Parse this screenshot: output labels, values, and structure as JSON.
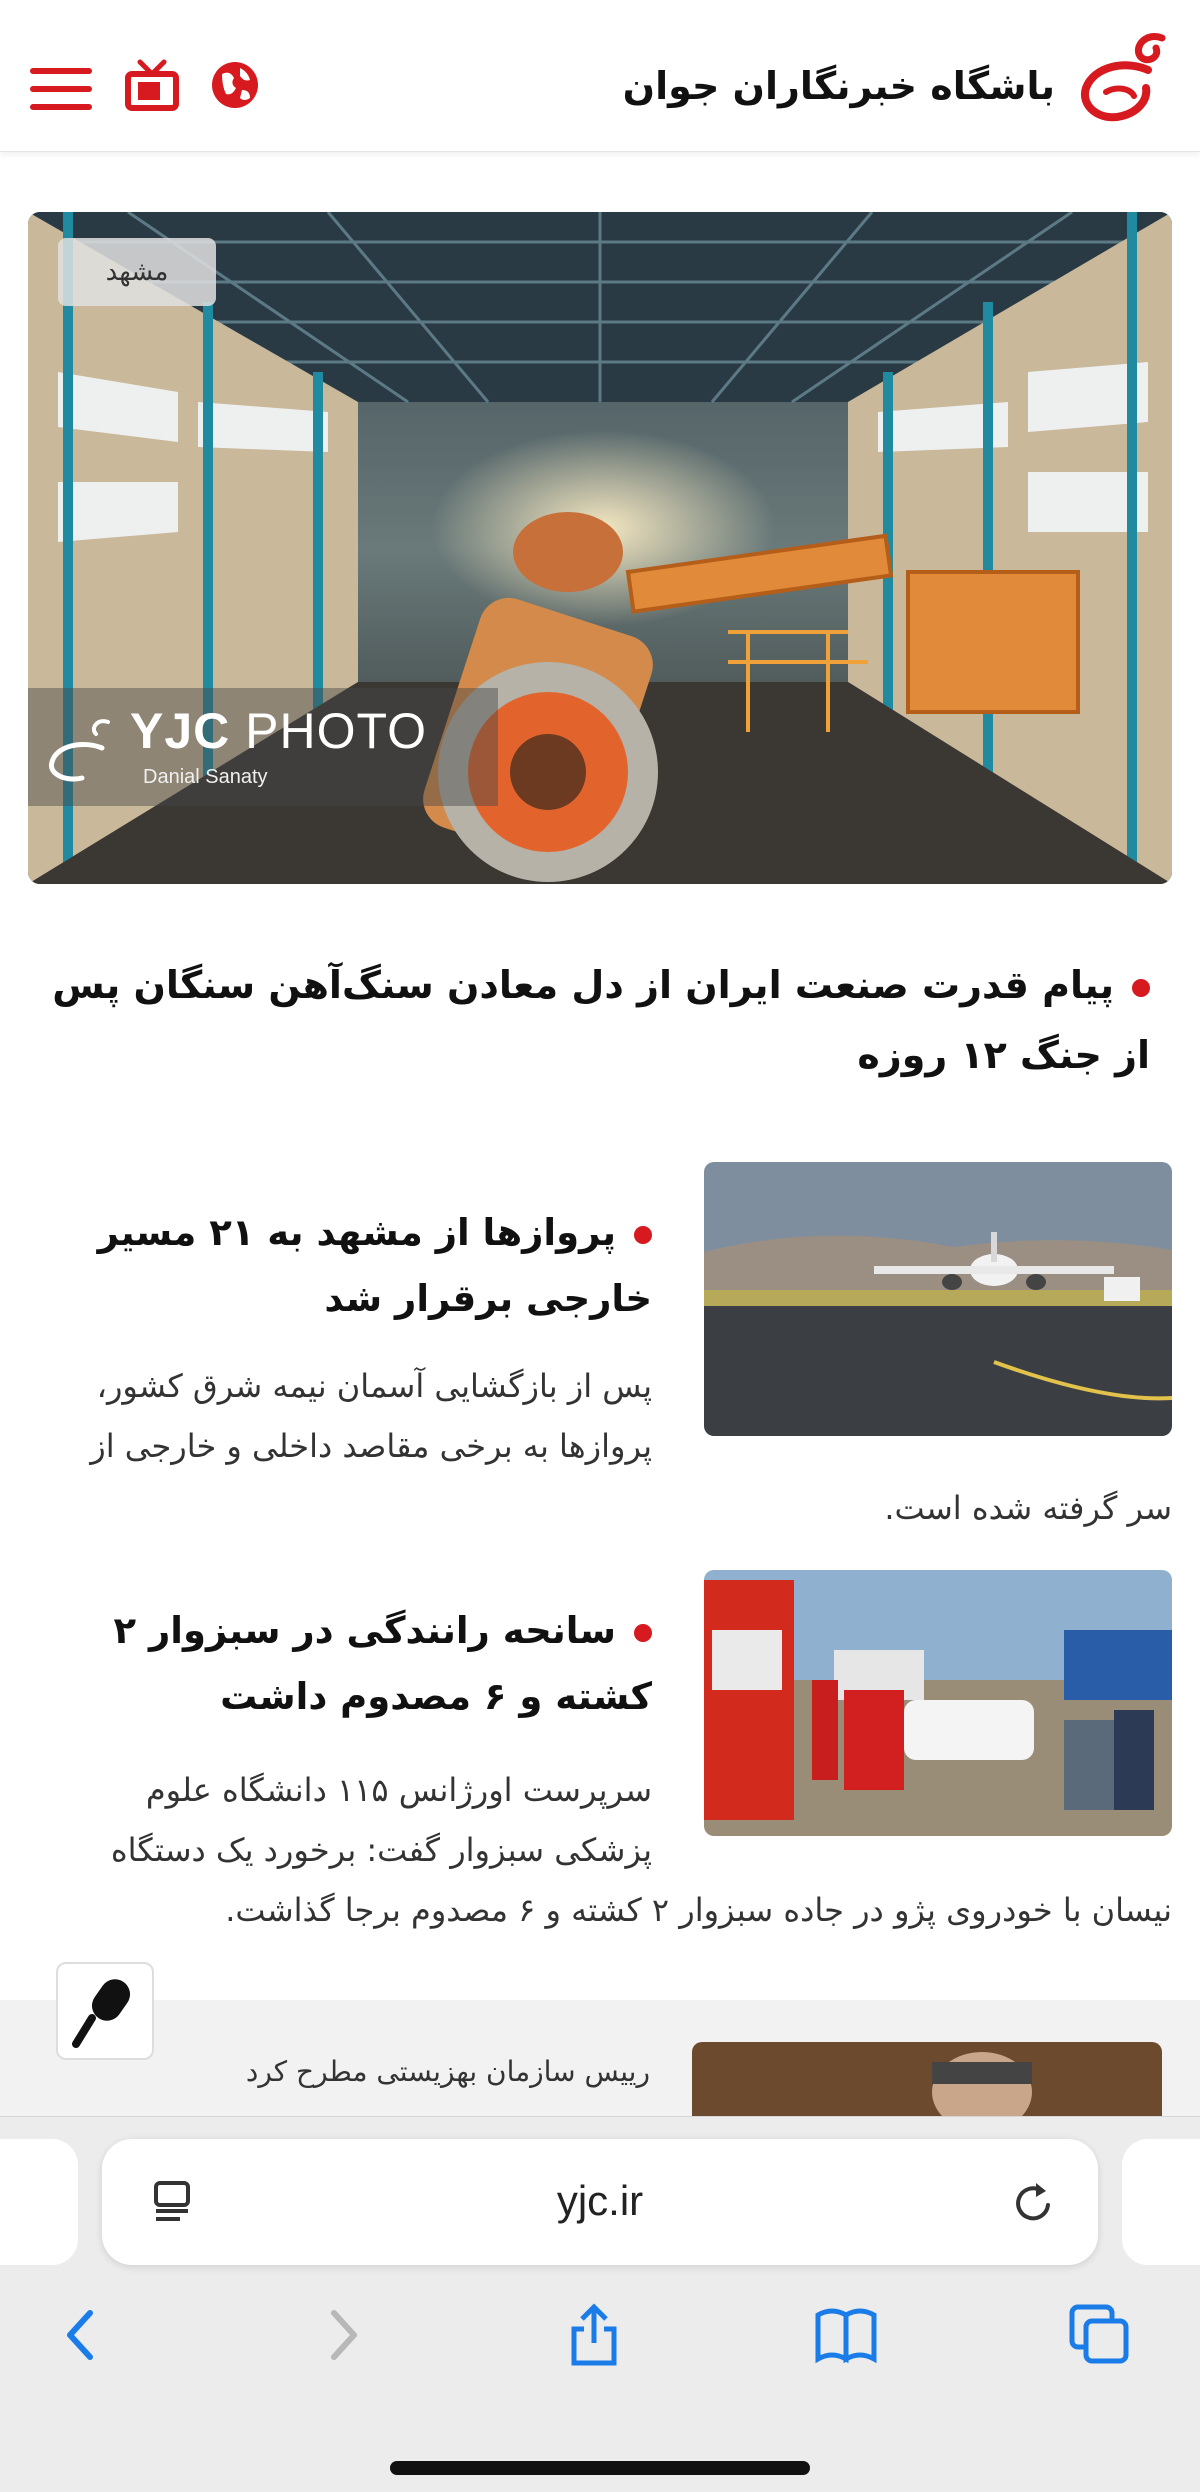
{
  "header": {
    "site_title": "باشگاه خبرنگاران جوان",
    "menu_icon": "hamburger-menu-icon",
    "tv_icon": "tv-icon",
    "globe_icon": "globe-icon",
    "brand_color": "#d71920"
  },
  "hero": {
    "location_tag": "مشهد",
    "watermark_brand": "YJC",
    "watermark_word": "PHOTO",
    "watermark_author": "Danial Sanaty",
    "headline": "پیام قدرت صنعت ایران از دل معادن سنگ‌آهن سنگان پس از جنگ ۱۲ روزه"
  },
  "news": [
    {
      "title": "پروازها از مشهد به ۲۱ مسیر خارجی برقرار شد",
      "text_line1": "پس از بازگشایی آسمان نیمه شرق کشور،",
      "text_line2": "پروازها به برخی مقاصد داخلی و خارجی از",
      "text_line3": "سر گرفته شده است."
    },
    {
      "title": "سانحه رانندگی در سبزوار ۲ کشته و ۶ مصدوم داشت",
      "text_line1": "سرپرست اورژانس ۱۱۵ دانشگاه علوم",
      "text_line2": "پزشکی سبزوار گفت: برخورد یک دستگاه",
      "text_line3": "نیسان با خودروی پژو در جاده سبزوار ۲ کشته و ۶ مصدوم برجا گذاشت."
    }
  ],
  "next_item": {
    "text": "رییس سازمان بهزیستی مطرح کرد"
  },
  "browser": {
    "url": "yjc.ir",
    "toolbar_icons": [
      "back-icon",
      "forward-icon",
      "share-icon",
      "bookmarks-icon",
      "tabs-icon"
    ]
  }
}
